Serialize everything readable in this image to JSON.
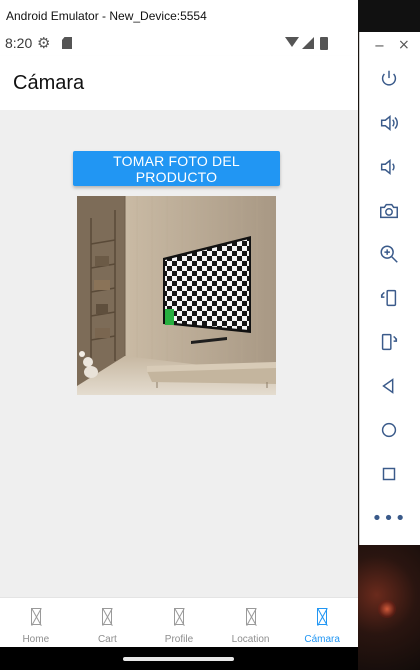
{
  "window": {
    "title": "Android Emulator - New_Device:5554"
  },
  "status_bar": {
    "time": "8:20"
  },
  "app_bar": {
    "title": "Cámara"
  },
  "main": {
    "take_photo_label": "TOMAR FOTO DEL PRODUCTO",
    "photo_alt": ""
  },
  "tabs": [
    {
      "label": "Home",
      "active": false
    },
    {
      "label": "Cart",
      "active": false
    },
    {
      "label": "Profile",
      "active": false
    },
    {
      "label": "Location",
      "active": false
    },
    {
      "label": "Cámara",
      "active": true
    }
  ],
  "toolbar": {
    "minimize": "−",
    "close": "×",
    "buttons": [
      "power-icon",
      "volume-up-icon",
      "volume-down-icon",
      "camera-icon",
      "zoom-icon",
      "rotate-left-icon",
      "rotate-right-icon",
      "back-icon",
      "home-icon",
      "overview-icon",
      "more-icon"
    ],
    "more": "•••"
  },
  "colors": {
    "accent": "#2196f3",
    "content_bg": "#efefef",
    "tab_inactive": "#8e8e8e"
  }
}
